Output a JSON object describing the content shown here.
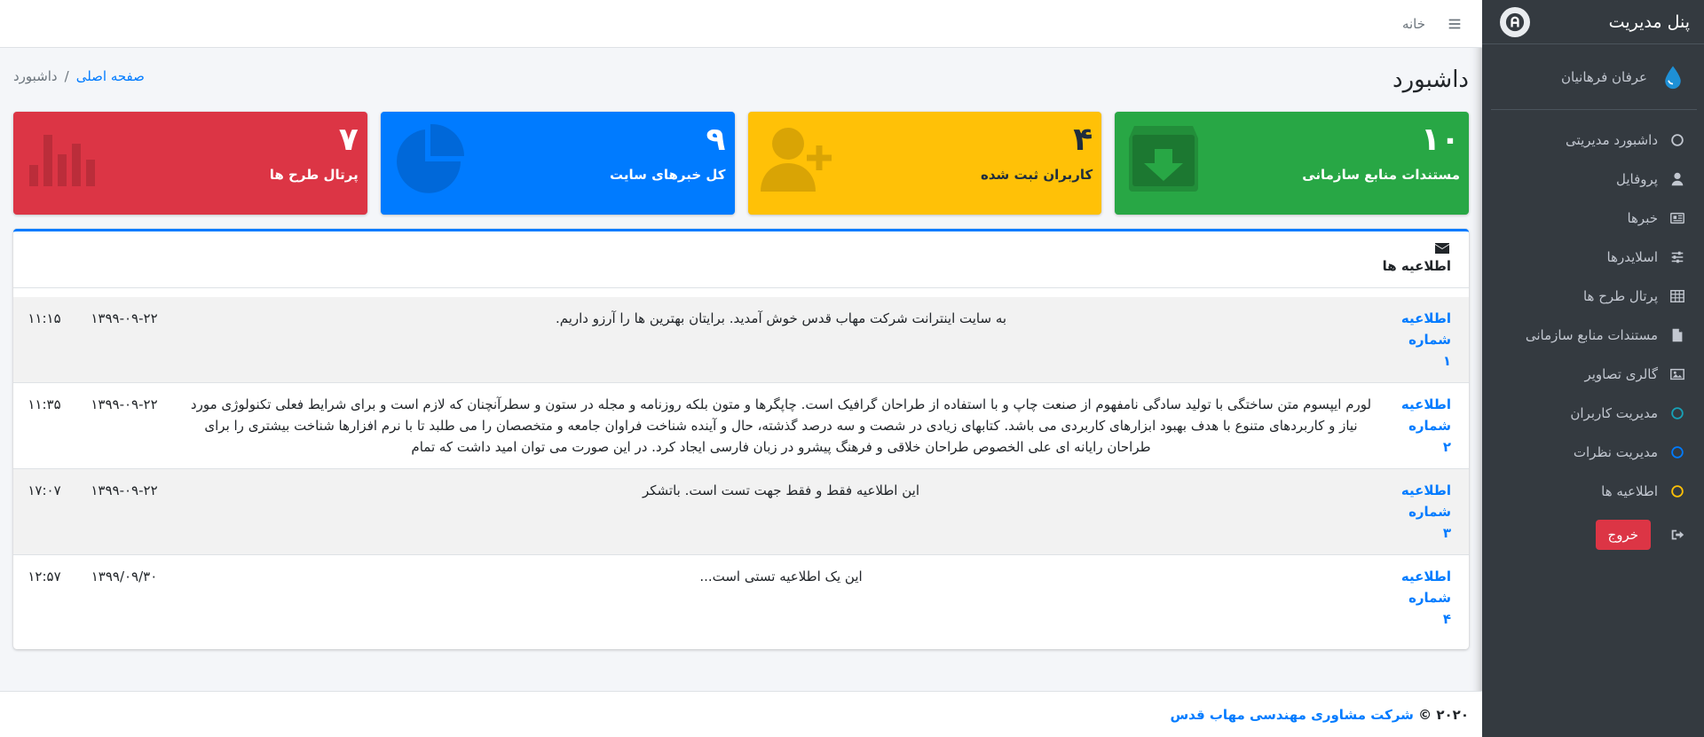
{
  "sidebar": {
    "brand": "پنل مدیریت",
    "user_name": "عرفان فرهانیان",
    "items": [
      {
        "label": "داشبورد مدیریتی",
        "icon": "circle-outline-icon"
      },
      {
        "label": "پروفایل",
        "icon": "user-icon"
      },
      {
        "label": "خبرها",
        "icon": "newspaper-icon"
      },
      {
        "label": "اسلایدرها",
        "icon": "sliders-icon"
      },
      {
        "label": "پرتال طرح ها",
        "icon": "table-icon"
      },
      {
        "label": "مستندات منابع سازمانی",
        "icon": "file-icon"
      },
      {
        "label": "گالری تصاویر",
        "icon": "image-icon"
      },
      {
        "label": "مدیریت کاربران",
        "icon": "circle-outline-icon",
        "color": "#17a2b8"
      },
      {
        "label": "مدیریت نظرات",
        "icon": "circle-outline-icon",
        "color": "#007bff"
      },
      {
        "label": "اطلاعیه ها",
        "icon": "circle-outline-icon",
        "color": "#ffc107"
      }
    ],
    "logout_label": "خروج"
  },
  "topbar": {
    "home_link": "خانه"
  },
  "header": {
    "title": "داشبورد",
    "breadcrumb_home": "صفحه اصلی",
    "breadcrumb_sep": "/",
    "breadcrumb_current": "داشبورد"
  },
  "boxes": [
    {
      "value": "۱۰",
      "label": "مستندات منابع سازمانی",
      "color": "#28a745",
      "icon": "archive-icon"
    },
    {
      "value": "۴",
      "label": "کاربران ثبت شده",
      "color": "#ffc107",
      "icon": "user-plus-icon"
    },
    {
      "value": "۹",
      "label": "کل خبرهای سایت",
      "color": "#007bff",
      "icon": "pie-chart-icon"
    },
    {
      "value": "۷",
      "label": "پرتال طرح ها",
      "color": "#dc3545",
      "icon": "bar-chart-icon"
    }
  ],
  "notices": {
    "title": "اطلاعیه ها",
    "rows": [
      {
        "title_a": "اطلاعیه",
        "title_b": "شماره ۱",
        "text": "به سایت اینترانت شرکت مهاب قدس خوش آمدید. برایتان بهترین ها را آرزو داریم.",
        "date": "۱۳۹۹-۰۹-۲۲",
        "time": "۱۱:۱۵"
      },
      {
        "title_a": "اطلاعیه",
        "title_b": "شماره ۲",
        "text": "لورم ایپسوم متن ساختگی با تولید سادگی نامفهوم از صنعت چاپ و با استفاده از طراحان گرافیک است. چاپگرها و متون بلکه روزنامه و مجله در ستون و سطرآنچنان که لازم است و برای شرایط فعلی تکنولوژی مورد نیاز و کاربردهای متنوع با هدف بهبود ابزارهای کاربردی می باشد. کتابهای زیادی در شصت و سه درصد گذشته، حال و آینده شناخت فراوان جامعه و متخصصان را می طلبد تا با نرم افزارها شناخت بیشتری را برای طراحان رایانه ای علی الخصوص طراحان خلاقی و فرهنگ پیشرو در زبان فارسی ایجاد کرد. در این صورت می توان امید داشت که تمام",
        "date": "۱۳۹۹-۰۹-۲۲",
        "time": "۱۱:۳۵"
      },
      {
        "title_a": "اطلاعیه",
        "title_b": "شماره ۳",
        "text": "این اطلاعیه فقط و فقط جهت تست است. باتشکر",
        "date": "۱۳۹۹-۰۹-۲۲",
        "time": "۱۷:۰۷"
      },
      {
        "title_a": "اطلاعیه",
        "title_b": "شماره ۴",
        "text": "این یک اطلاعیه تستی است...",
        "date": "۱۳۹۹/۰۹/۳۰",
        "time": "۱۲:۵۷"
      }
    ]
  },
  "footer": {
    "year": "۲۰۲۰ ©",
    "company": "شرکت مشاوری مهندسی مهاب قدس"
  }
}
